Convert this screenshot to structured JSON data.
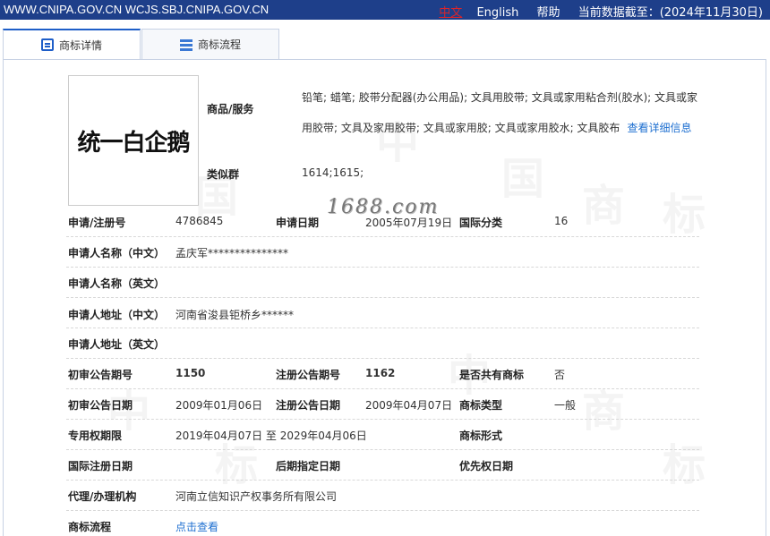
{
  "topbar": {
    "domains": "WWW.CNIPA.GOV.CN WCJS.SBJ.CNIPA.GOV.CN",
    "lang_cn": "中文",
    "lang_en": "English",
    "help": "帮助",
    "data_date": "当前数据截至：(2024年11月30日)"
  },
  "tabs": [
    {
      "label": "商标详情",
      "icon": "document-icon",
      "active": true
    },
    {
      "label": "商标流程",
      "icon": "list-icon",
      "active": false
    }
  ],
  "watermark_site": "1688.com",
  "logo_text": "统一白企鹅",
  "goods": {
    "label": "商品/服务",
    "text": "铅笔; 蜡笔; 胶带分配器(办公用品); 文具用胶带; 文具或家用粘合剂(胶水); 文具或家用胶带; 文具及家用胶带; 文具或家用胶; 文具或家用胶水; 文具胶布",
    "link": "查看详细信息"
  },
  "similar_group": {
    "label": "类似群",
    "value": "1614;1615;"
  },
  "fields": {
    "reg_no": {
      "label": "申请/注册号",
      "value": "4786845"
    },
    "apply_date": {
      "label": "申请日期",
      "value": "2005年07月19日"
    },
    "intl_class": {
      "label": "国际分类",
      "value": "16"
    },
    "applicant_cn": {
      "label": "申请人名称（中文）",
      "value": "孟庆军***************"
    },
    "applicant_en": {
      "label": "申请人名称（英文）",
      "value": ""
    },
    "address_cn": {
      "label": "申请人地址（中文）",
      "value": "河南省浚县钜桥乡******"
    },
    "address_en": {
      "label": "申请人地址（英文）",
      "value": ""
    },
    "prelim_no": {
      "label": "初审公告期号",
      "value": "1150"
    },
    "reg_pub_no": {
      "label": "注册公告期号",
      "value": "1162"
    },
    "shared": {
      "label": "是否共有商标",
      "value": "否"
    },
    "prelim_date": {
      "label": "初审公告日期",
      "value": "2009年01月06日"
    },
    "reg_pub_date": {
      "label": "注册公告日期",
      "value": "2009年04月07日"
    },
    "tm_type": {
      "label": "商标类型",
      "value": "一般"
    },
    "exclusive_period": {
      "label": "专用权期限",
      "value": "2019年04月07日 至 2029年04月06日"
    },
    "tm_form": {
      "label": "商标形式",
      "value": ""
    },
    "intl_reg_date": {
      "label": "国际注册日期",
      "value": ""
    },
    "later_designation": {
      "label": "后期指定日期",
      "value": ""
    },
    "priority_date": {
      "label": "优先权日期",
      "value": ""
    },
    "agency": {
      "label": "代理/办理机构",
      "value": "河南立信知识产权事务所有限公司"
    },
    "process": {
      "label": "商标流程",
      "value": "点击查看"
    }
  }
}
